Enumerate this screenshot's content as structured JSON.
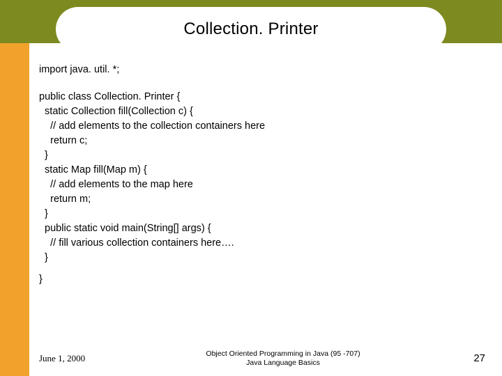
{
  "title": "Collection. Printer",
  "code": {
    "import_line": "import java. util. *;",
    "body": "public class Collection. Printer {\n  static Collection fill(Collection c) {\n    // add elements to the collection containers here\n    return c;\n  }\n  static Map fill(Map m) {\n    // add elements to the map here\n    return m;\n  }\n  public static void main(String[] args) {\n    // fill various collection containers here….\n  }",
    "closing": "}"
  },
  "footer": {
    "date": "June 1, 2000",
    "center_line1": "Object Oriented Programming in Java  (95 -707)",
    "center_line2": "Java Language Basics",
    "page": "27"
  }
}
